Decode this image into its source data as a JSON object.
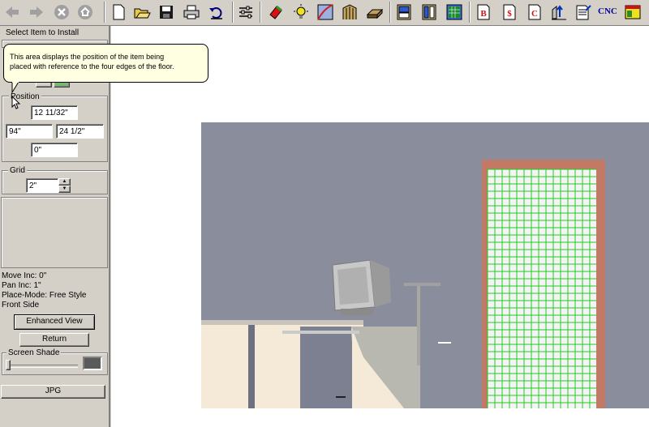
{
  "toolbar": {
    "icons": [
      "back-arrow-icon",
      "forward-arrow-icon",
      "stop-icon",
      "home-icon",
      "new-file-icon",
      "open-folder-icon",
      "save-icon",
      "print-icon",
      "undo-icon",
      "settings-sliders-icon",
      "paint-icon",
      "light-icon",
      "surface-icon",
      "wall-icon",
      "floor-icon",
      "cabinet-icon",
      "cabinet-panel-icon",
      "grid-panel-icon",
      "b-report-icon",
      "price-report-icon",
      "c-report-icon",
      "elevation-icon",
      "document-icon",
      "cnc-icon",
      "layout-icon"
    ],
    "cnc_label": "CNC"
  },
  "left_panel": {
    "select_item_label": "Select Item to Install",
    "position_label": "Position",
    "position_top": "12 11/32\"",
    "position_left": "94\"",
    "position_right": "24 1/2\"",
    "position_bottom": "0\"",
    "grid_label": "Grid",
    "grid_value": "2\"",
    "move_inc": "Move Inc: 0\"",
    "pan_inc": "Pan Inc: 1\"",
    "place_mode": "Place-Mode: Free Style",
    "side": "Front Side",
    "enhanced_view_button": "Enhanced View",
    "return_button": "Return",
    "screen_shade_label": "Screen Shade",
    "jpg_button": "JPG"
  },
  "tooltip": {
    "line1": "This area displays the position of the item being",
    "line2": "placed with reference to the four edges of the floor."
  },
  "colors": {
    "wall": "#8a8e9c",
    "floor": "#f5ead8",
    "grid_green": "#22cc22"
  }
}
